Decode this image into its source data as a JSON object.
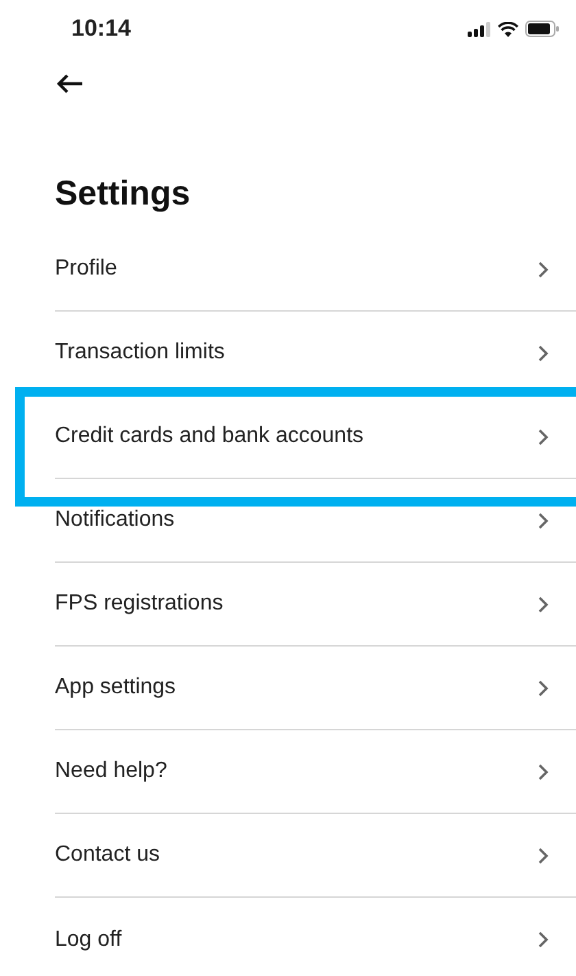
{
  "status_bar": {
    "time": "10:14"
  },
  "title": "Settings",
  "items": [
    {
      "label": "Profile",
      "highlighted": false
    },
    {
      "label": "Transaction limits",
      "highlighted": false
    },
    {
      "label": "Credit cards and bank accounts",
      "highlighted": true
    },
    {
      "label": "Notifications",
      "highlighted": false
    },
    {
      "label": "FPS registrations",
      "highlighted": false
    },
    {
      "label": "App settings",
      "highlighted": false
    },
    {
      "label": "Need help?",
      "highlighted": false
    },
    {
      "label": "Contact us",
      "highlighted": false
    },
    {
      "label": "Log off",
      "highlighted": false
    }
  ]
}
